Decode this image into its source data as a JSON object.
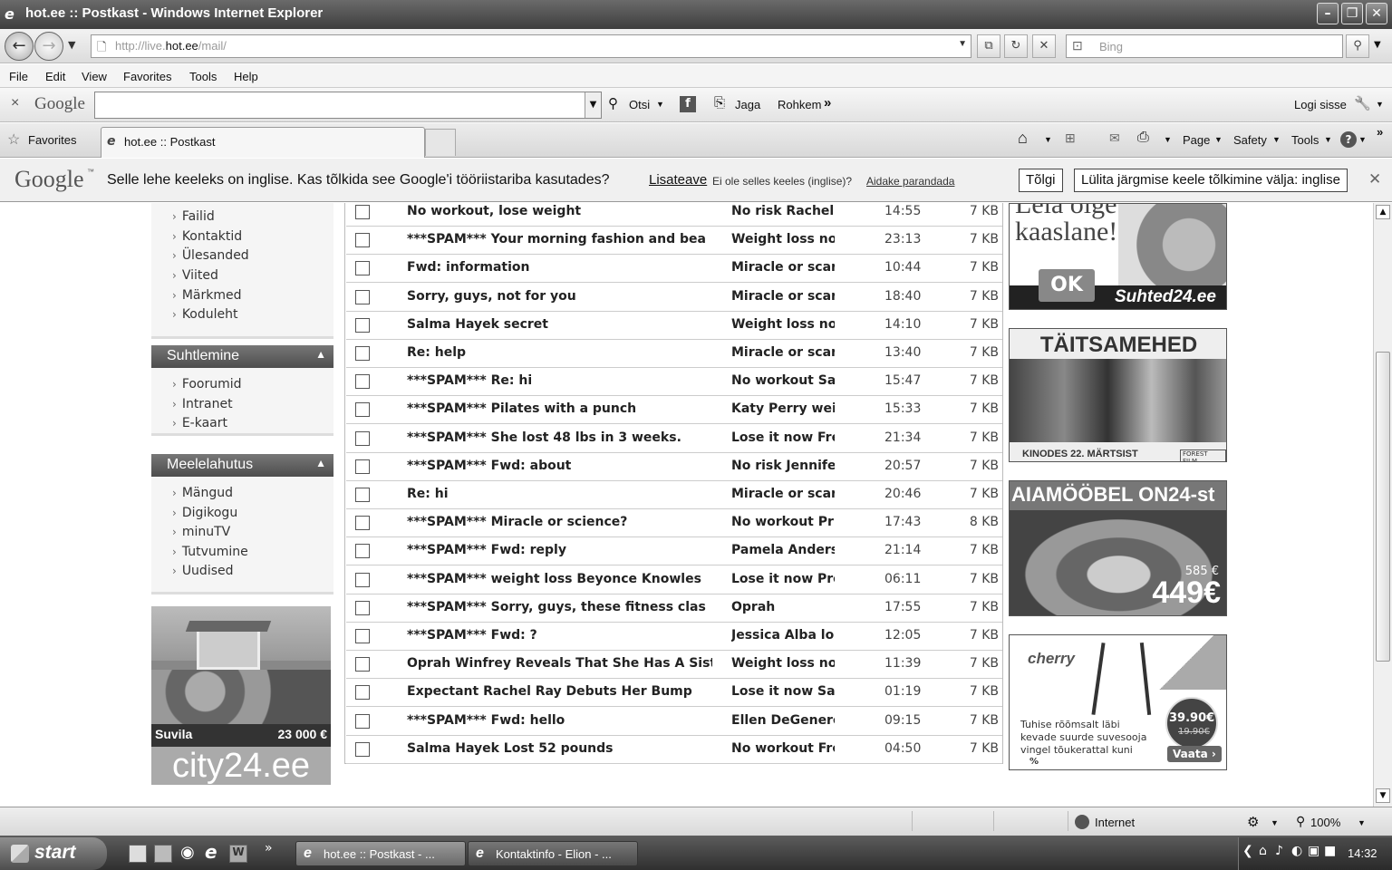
{
  "window": {
    "title": "hot.ee :: Postkast - Windows Internet Explorer",
    "minimize_icon": "minimize-icon",
    "restore_icon": "restore-icon",
    "close_icon": "close-icon"
  },
  "address": {
    "url_prefix": "http://live.",
    "url_domain": "hot.ee",
    "url_suffix": "/mail/",
    "search_placeholder": "Bing"
  },
  "menu": [
    "File",
    "Edit",
    "View",
    "Favorites",
    "Tools",
    "Help"
  ],
  "google_toolbar": {
    "close": "×",
    "logo": "Google",
    "search_label": "Otsi",
    "share_label": "Jaga",
    "more_label": "Rohkem",
    "more_arrows": "»",
    "signin_label": "Logi sisse"
  },
  "tabs": {
    "favorites_label": "Favorites",
    "active_tab": "hot.ee :: Postkast",
    "cmd_page": "Page",
    "cmd_safety": "Safety",
    "cmd_tools": "Tools"
  },
  "translate_bar": {
    "logo": "Google",
    "logo_tm": "™",
    "message": "Selle lehe keeleks on inglise. Kas tõlkida see Google'i tööriistariba kasutades?",
    "learn_more": "Lisateave",
    "not_this_lang": "Ei ole selles keeles (inglise)?",
    "help_fix": "Aidake parandada",
    "translate_btn": "Tõlgi",
    "disable_btn": "Lülita järgmise keele tõlkimine välja: inglise",
    "close": "✕"
  },
  "sidebar": {
    "group1": [
      "Failid",
      "Kontaktid",
      "Ülesanded",
      "Viited",
      "Märkmed",
      "Koduleht"
    ],
    "suhtlemine": {
      "title": "Suhtlemine",
      "items": [
        "Foorumid",
        "Intranet",
        "E-kaart"
      ]
    },
    "meelelahutus": {
      "title": "Meelelahutus",
      "items": [
        "Mängud",
        "Digikogu",
        "minuTV",
        "Tutvumine",
        "Uudised"
      ]
    },
    "city24_ad": {
      "label": "Suvila",
      "price": "23 000 €",
      "brand": "city24.ee"
    }
  },
  "mail_rows": [
    {
      "subject": "No workout, lose weight",
      "from": "No risk Rachel",
      "time": "14:55",
      "size": "7 KB"
    },
    {
      "subject": "***SPAM*** Your morning fashion and bea",
      "from": "Weight loss no",
      "time": "23:13",
      "size": "7 KB"
    },
    {
      "subject": "Fwd: information",
      "from": "Miracle or scar",
      "time": "10:44",
      "size": "7 KB"
    },
    {
      "subject": "Sorry, guys, not for you",
      "from": "Miracle or scar",
      "time": "18:40",
      "size": "7 KB"
    },
    {
      "subject": "Salma Hayek secret",
      "from": "Weight loss no",
      "time": "14:10",
      "size": "7 KB"
    },
    {
      "subject": "Re: help",
      "from": "Miracle or scar",
      "time": "13:40",
      "size": "7 KB"
    },
    {
      "subject": "***SPAM*** Re: hi",
      "from": "No workout Sa",
      "time": "15:47",
      "size": "7 KB"
    },
    {
      "subject": "***SPAM*** Pilates with a punch",
      "from": "Katy Perry wei",
      "time": "15:33",
      "size": "7 KB"
    },
    {
      "subject": "***SPAM*** She lost 48 lbs in 3 weeks.",
      "from": "Lose it now Fre",
      "time": "21:34",
      "size": "7 KB"
    },
    {
      "subject": "***SPAM*** Fwd: about",
      "from": "No risk Jennife",
      "time": "20:57",
      "size": "7 KB"
    },
    {
      "subject": "Re: hi",
      "from": "Miracle or scar",
      "time": "20:46",
      "size": "7 KB"
    },
    {
      "subject": "***SPAM*** Miracle or science?",
      "from": "No workout Pr",
      "time": "17:43",
      "size": "8 KB"
    },
    {
      "subject": "***SPAM*** Fwd: reply",
      "from": "Pamela Anders",
      "time": "21:14",
      "size": "7 KB"
    },
    {
      "subject": "***SPAM*** weight loss Beyonce Knowles",
      "from": "Lose it now Pro",
      "time": "06:11",
      "size": "7 KB"
    },
    {
      "subject": "***SPAM*** Sorry, guys, these fitness clas",
      "from": "Oprah",
      "time": "17:55",
      "size": "7 KB"
    },
    {
      "subject": "***SPAM*** Fwd: ?",
      "from": "Jessica Alba lo",
      "time": "12:05",
      "size": "7 KB"
    },
    {
      "subject": "Oprah Winfrey Reveals That She Has A Sist",
      "from": "Weight loss no",
      "time": "11:39",
      "size": "7 KB"
    },
    {
      "subject": "Expectant Rachel Ray Debuts Her Bump",
      "from": "Lose it now Sa",
      "time": "01:19",
      "size": "7 KB"
    },
    {
      "subject": "***SPAM*** Fwd: hello",
      "from": "Ellen DeGenere",
      "time": "09:15",
      "size": "7 KB"
    },
    {
      "subject": "Salma Hayek Lost 52 pounds",
      "from": "No workout Fre",
      "time": "04:50",
      "size": "7 KB"
    }
  ],
  "ads": {
    "suhted": {
      "headline": "Leia oige kaaslane!",
      "ok": "OK",
      "brand": "Suhted24.ee"
    },
    "taitsamehed": {
      "title": "TÄITSAMEHED",
      "subtitle": "KINODES 22. MÄRTSIST",
      "logo": "FOREST FILM"
    },
    "aiamoobel": {
      "title": "AIAMÖÖBEL ON24-st",
      "old_price": "585 €",
      "price": "449€"
    },
    "cherry": {
      "brand": "cherry",
      "text": "Tuhise rõõmsalt läbi kevade suurde suvesooja vingel tõukerattal kuni",
      "price": "39.90€",
      "old_price": "19.90€",
      "cta": "Vaata ›",
      "percent": "%"
    }
  },
  "status": {
    "zone": "Internet",
    "zoom": "100%"
  },
  "taskbar": {
    "start": "start",
    "task1": "hot.ee :: Postkast - ...",
    "task2": "Kontaktinfo - Elion - ...",
    "more": "»",
    "clock": "14:32"
  }
}
